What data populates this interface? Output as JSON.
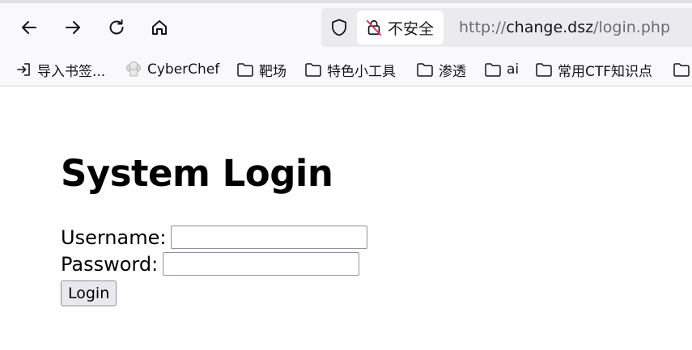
{
  "browser": {
    "security_label": "不安全",
    "url_scheme": "http://",
    "url_host": "change.dsz",
    "url_path": "/login.php"
  },
  "bookmarks": [
    {
      "label": "导入书签...",
      "icon": "import-icon"
    },
    {
      "label": "CyberChef",
      "icon": "chef-hat-icon"
    },
    {
      "label": "靶场",
      "icon": "folder-icon"
    },
    {
      "label": "特色小工具",
      "icon": "folder-icon"
    },
    {
      "label": "渗透",
      "icon": "folder-icon"
    },
    {
      "label": "ai",
      "icon": "folder-icon"
    },
    {
      "label": "常用CTF知识点",
      "icon": "folder-icon"
    }
  ],
  "page": {
    "title": "System Login",
    "username_label": "Username:",
    "username_value": "",
    "password_label": "Password:",
    "password_value": "",
    "login_button": "Login"
  }
}
